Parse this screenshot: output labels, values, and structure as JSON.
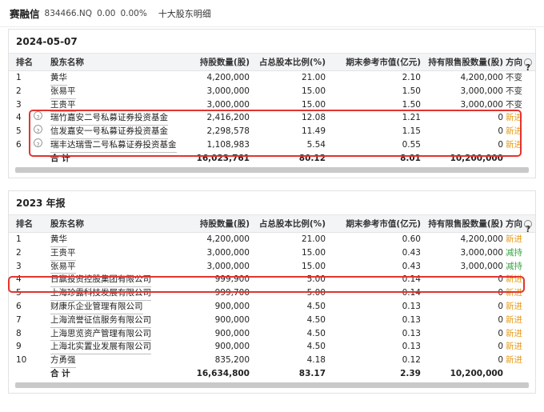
{
  "header": {
    "stock_name": "赛融信",
    "stock_code": "834466.NQ",
    "price": "0.00",
    "change_pct": "0.00%",
    "page_title": "十大股东明细"
  },
  "columns": {
    "rank": "排名",
    "name": "股东名称",
    "qty": "持股数量(股)",
    "ratio": "占总股本比例(%)",
    "mv": "期末参考市值(亿元)",
    "limited": "持有限售股数量(股)",
    "direction": "方向"
  },
  "sections": [
    {
      "title": "2024-05-07",
      "rows": [
        {
          "rank": "1",
          "name": "黄华",
          "qty": "4,200,000",
          "ratio": "21.00",
          "mv": "2.10",
          "limited": "4,200,000",
          "direction": "不变",
          "dir_type": "flat",
          "fund": false
        },
        {
          "rank": "2",
          "name": "张易平",
          "qty": "3,000,000",
          "ratio": "15.00",
          "mv": "1.50",
          "limited": "3,000,000",
          "direction": "不变",
          "dir_type": "flat",
          "fund": false
        },
        {
          "rank": "3",
          "name": "王贵平",
          "qty": "3,000,000",
          "ratio": "15.00",
          "mv": "1.50",
          "limited": "3,000,000",
          "direction": "不变",
          "dir_type": "flat",
          "fund": false
        },
        {
          "rank": "4",
          "name": "瑞竹嘉安二号私募证券投资基金",
          "qty": "2,416,200",
          "ratio": "12.08",
          "mv": "1.21",
          "limited": "0",
          "direction": "新进",
          "dir_type": "new",
          "fund": true
        },
        {
          "rank": "5",
          "name": "信发嘉安一号私募证券投资基金",
          "qty": "2,298,578",
          "ratio": "11.49",
          "mv": "1.15",
          "limited": "0",
          "direction": "新进",
          "dir_type": "new",
          "fund": true
        },
        {
          "rank": "6",
          "name": "瑞丰达瑞雪二号私募证券投资基金",
          "qty": "1,108,983",
          "ratio": "5.54",
          "mv": "0.55",
          "limited": "0",
          "direction": "新进",
          "dir_type": "new",
          "fund": true
        }
      ],
      "total": {
        "label": "合 计",
        "qty": "16,023,761",
        "ratio": "80.12",
        "mv": "8.01",
        "limited": "10,200,000"
      }
    },
    {
      "title": "2023 年报",
      "rows": [
        {
          "rank": "1",
          "name": "黄华",
          "qty": "4,200,000",
          "ratio": "21.00",
          "mv": "0.60",
          "limited": "4,200,000",
          "direction": "新进",
          "dir_type": "new",
          "fund": false
        },
        {
          "rank": "2",
          "name": "王贵平",
          "qty": "3,000,000",
          "ratio": "15.00",
          "mv": "0.43",
          "limited": "3,000,000",
          "direction": "减持",
          "dir_type": "down",
          "fund": false
        },
        {
          "rank": "3",
          "name": "张易平",
          "qty": "3,000,000",
          "ratio": "15.00",
          "mv": "0.43",
          "limited": "3,000,000",
          "direction": "减持",
          "dir_type": "down",
          "fund": false
        },
        {
          "rank": "4",
          "name": "日赢投资控股集团有限公司",
          "qty": "999,900",
          "ratio": "5.00",
          "mv": "0.14",
          "limited": "0",
          "direction": "新进",
          "dir_type": "new",
          "fund": false
        },
        {
          "rank": "5",
          "name": "上海珍露科技发展有限公司",
          "qty": "999,700",
          "ratio": "5.00",
          "mv": "0.14",
          "limited": "0",
          "direction": "新进",
          "dir_type": "new",
          "fund": false
        },
        {
          "rank": "6",
          "name": "财康乐企业管理有限公司",
          "qty": "900,000",
          "ratio": "4.50",
          "mv": "0.13",
          "limited": "0",
          "direction": "新进",
          "dir_type": "new",
          "fund": false
        },
        {
          "rank": "7",
          "name": "上海流誉征信服务有限公司",
          "qty": "900,000",
          "ratio": "4.50",
          "mv": "0.13",
          "limited": "0",
          "direction": "新进",
          "dir_type": "new",
          "fund": false
        },
        {
          "rank": "8",
          "name": "上海思览资产管理有限公司",
          "qty": "900,000",
          "ratio": "4.50",
          "mv": "0.13",
          "limited": "0",
          "direction": "新进",
          "dir_type": "new",
          "fund": false
        },
        {
          "rank": "9",
          "name": "上海北实置业发展有限公司",
          "qty": "900,000",
          "ratio": "4.50",
          "mv": "0.13",
          "limited": "0",
          "direction": "新进",
          "dir_type": "new",
          "fund": false
        },
        {
          "rank": "10",
          "name": "方勇强",
          "qty": "835,200",
          "ratio": "4.18",
          "mv": "0.12",
          "limited": "0",
          "direction": "新进",
          "dir_type": "new",
          "fund": false
        }
      ],
      "total": {
        "label": "合 计",
        "qty": "16,634,800",
        "ratio": "83.17",
        "mv": "2.39",
        "limited": "10,200,000"
      }
    }
  ],
  "colors": {
    "new": "#e59a14",
    "down": "#3aa444",
    "highlight": "#e3342f"
  }
}
